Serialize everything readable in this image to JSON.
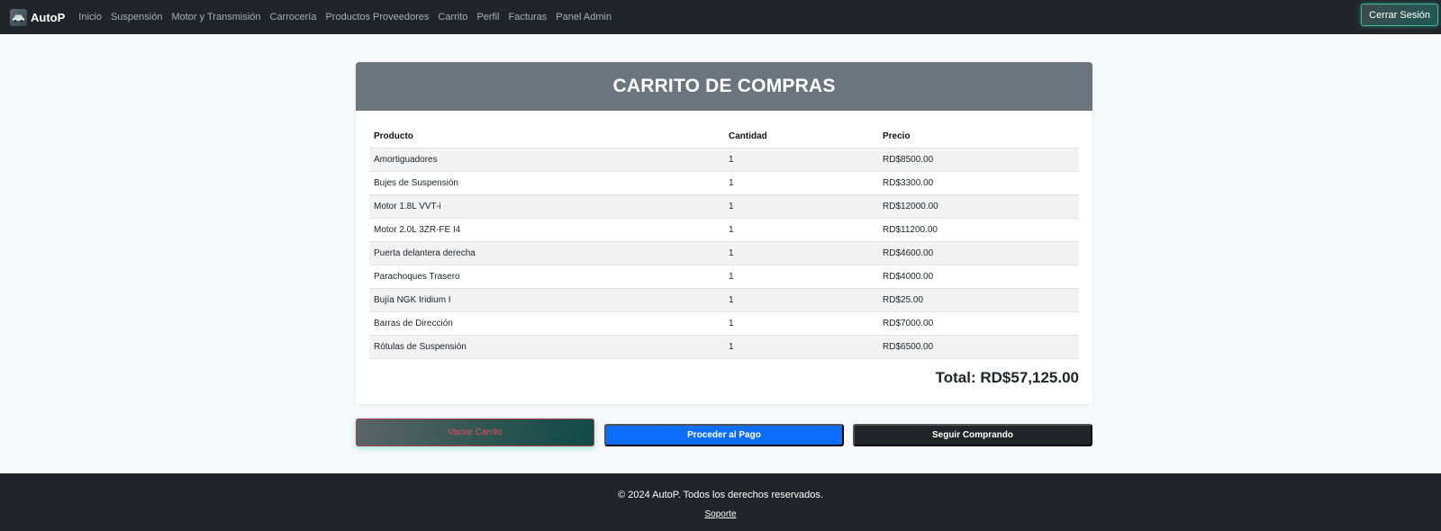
{
  "navbar": {
    "brand": "AutoP",
    "links": [
      {
        "label": "Inicio"
      },
      {
        "label": "Suspensión"
      },
      {
        "label": "Motor y Transmisión"
      },
      {
        "label": "Carrocería"
      },
      {
        "label": "Productos Proveedores"
      },
      {
        "label": "Carrito"
      },
      {
        "label": "Perfil"
      },
      {
        "label": "Facturas"
      },
      {
        "label": "Panel Admin"
      }
    ],
    "logout_label": "Cerrar Sesión"
  },
  "cart": {
    "title": "CARRITO DE COMPRAS",
    "columns": {
      "product": "Producto",
      "quantity": "Cantidad",
      "price": "Precio"
    },
    "items": [
      {
        "product": "Amortiguadores",
        "quantity": "1",
        "price": "RD$8500.00"
      },
      {
        "product": "Bujes de Suspensión",
        "quantity": "1",
        "price": "RD$3300.00"
      },
      {
        "product": "Motor 1.8L VVT-i",
        "quantity": "1",
        "price": "RD$12000.00"
      },
      {
        "product": "Motor 2.0L 3ZR-FE I4",
        "quantity": "1",
        "price": "RD$11200.00"
      },
      {
        "product": "Puerta delantera derecha",
        "quantity": "1",
        "price": "RD$4600.00"
      },
      {
        "product": "Parachoques Trasero",
        "quantity": "1",
        "price": "RD$4000.00"
      },
      {
        "product": "Bujía NGK Iridium I",
        "quantity": "1",
        "price": "RD$25.00"
      },
      {
        "product": "Barras de Dirección",
        "quantity": "1",
        "price": "RD$7000.00"
      },
      {
        "product": "Rótulas de Suspensión",
        "quantity": "1",
        "price": "RD$6500.00"
      }
    ],
    "total": "Total: RD$57,125.00"
  },
  "actions": {
    "clear_label": "Vaciar Carrito",
    "pay_label": "Proceder al Pago",
    "continue_label": "Seguir Comprando"
  },
  "footer": {
    "copyright": "© 2024 AutoP. Todos los derechos reservados.",
    "support_link": "Soporte"
  },
  "colors": {
    "navbar": "#212529",
    "header": "#6c757d",
    "primary": "#0d6efd",
    "dark": "#212529",
    "danger_text": "#e0505e"
  }
}
